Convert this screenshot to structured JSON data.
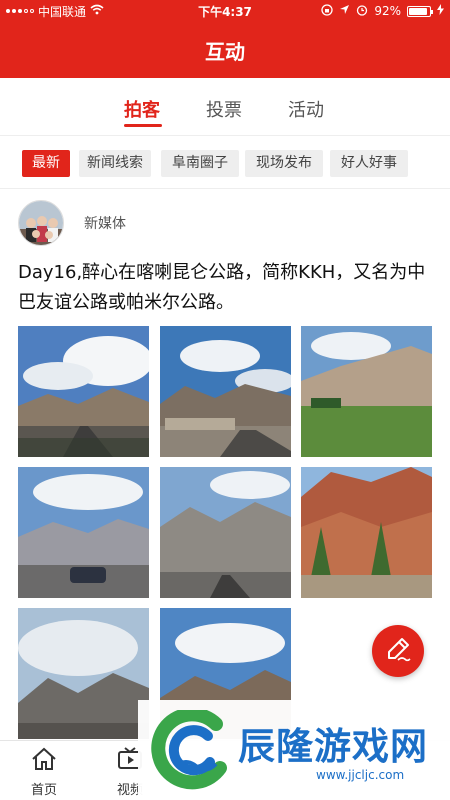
{
  "status": {
    "carrier": "中国联通",
    "time": "下午4:37",
    "battery_text": "92%",
    "battery_level": 0.92
  },
  "header": {
    "title": "互动"
  },
  "tabs": [
    {
      "label": "拍客",
      "active": true
    },
    {
      "label": "投票",
      "active": false
    },
    {
      "label": "活动",
      "active": false
    }
  ],
  "chips": [
    {
      "label": "最新",
      "active": true
    },
    {
      "label": "新闻线索",
      "active": false
    },
    {
      "label": "阜南圈子",
      "active": false
    },
    {
      "label": "现场发布",
      "active": false
    },
    {
      "label": "好人好事",
      "active": false
    }
  ],
  "post": {
    "author": "新媒体",
    "text": "Day16,醉心在喀喇昆仑公路，简称KKH，又名为中巴友谊公路或帕米尔公路。",
    "photo_count": 8
  },
  "fab": {
    "icon": "edit-pen-icon"
  },
  "bottom_nav": [
    {
      "label": "首页",
      "icon": "home-icon"
    },
    {
      "label": "视频",
      "icon": "video-icon"
    }
  ],
  "watermark": {
    "text": "辰隆游戏网",
    "url": "www.jjcljc.com"
  },
  "colors": {
    "brand": "#e1251b",
    "watermark_blue": "#1c6fc7",
    "watermark_green": "#3aa64a"
  }
}
